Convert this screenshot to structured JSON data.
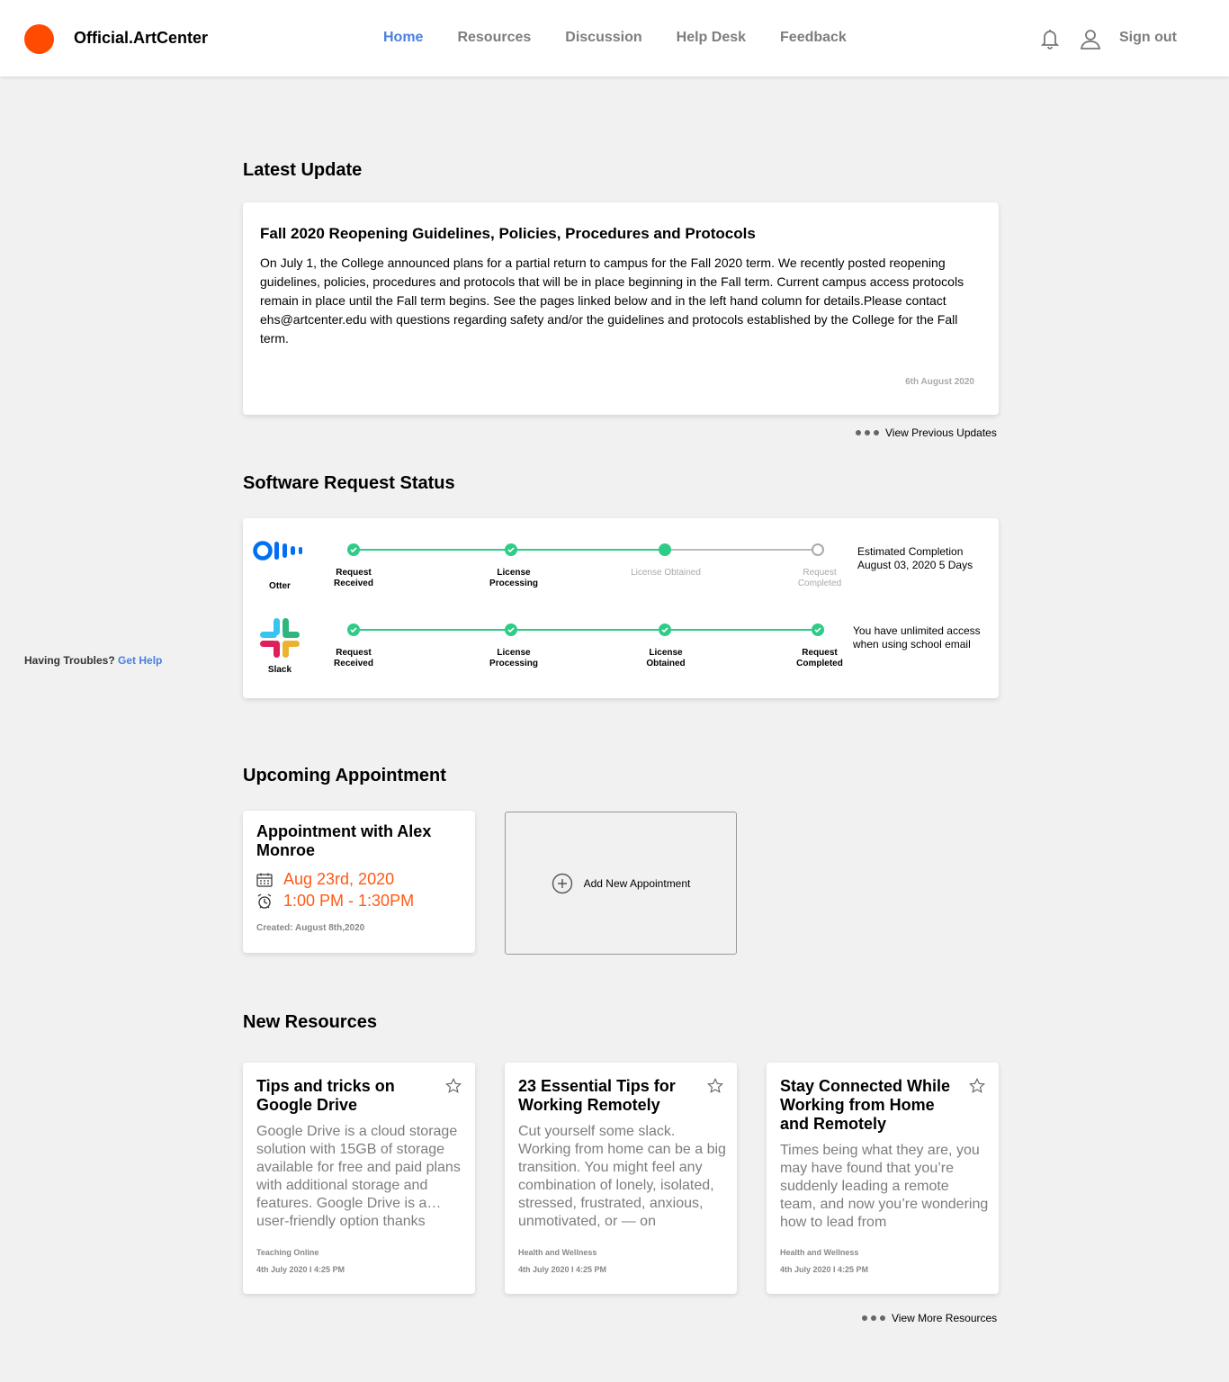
{
  "header": {
    "brand": "Official.ArtCenter",
    "nav": [
      "Home",
      "Resources",
      "Discussion",
      "Help Desk",
      "Feedback"
    ],
    "active_nav": "Home",
    "sign_out": "Sign out",
    "accent_color": "#4a7fe0",
    "logo_color": "#ff4b00"
  },
  "sidebar": {
    "help_text": "Having Troubles?",
    "help_link": "Get Help"
  },
  "latest": {
    "section_title": "Latest Update",
    "title": "Fall 2020 Reopening Guidelines, Policies, Procedures and Protocols",
    "body": "On July 1, the College announced plans for a partial return to campus for the Fall 2020 term. We recently posted reopening guidelines, policies, procedures and protocols that will be in place beginning in the Fall term. Current campus access protocols remain in place until the Fall term begins. See the pages linked below and in the left hand column for details.Please contact ehs@artcenter.edu with questions regarding safety and/or the guidelines and protocols established by the College for the Fall term.",
    "date": "6th August 2020",
    "view_previous": "View Previous Updates"
  },
  "software": {
    "section_title": "Software Request Status",
    "apps": [
      {
        "name": "Otter",
        "steps": [
          "Request Received",
          "License Processing",
          "License Obtained",
          "Request Completed"
        ],
        "note_line1": "Estimated Completion",
        "note_line2": "August 03, 2020 5 Days"
      },
      {
        "name": "Slack",
        "steps": [
          "Request Received",
          "License Processing",
          "License Obtained",
          "Request Completed"
        ],
        "note_line1": "You have unlimited access",
        "note_line2": "when using school email"
      }
    ],
    "status_color": "#2ecc87"
  },
  "appointment": {
    "section_title": "Upcoming Appointment",
    "title": "Appointment with Alex Monroe",
    "date": "Aug 23rd, 2020",
    "time": "1:00 PM - 1:30PM",
    "created": "Created: August 8th,2020",
    "add_label": "Add New Appointment",
    "highlight_color": "#ff5a14"
  },
  "resources": {
    "section_title": "New Resources",
    "items": [
      {
        "title": "Tips and tricks on Google Drive",
        "body": "Google Drive is a cloud storage solution with 15GB of storage available for free and paid plans with additional storage and features. Google Drive is a… user-friendly option thanks",
        "category": "Teaching Online",
        "date": "4th July 2020  I  4:25 PM"
      },
      {
        "title": "23 Essential Tips for Working Remotely",
        "body": "Cut yourself some slack. Working from home can be a big transition. You might feel any combination of lonely, isolated, stressed, frustrated, anxious, unmotivated, or — on",
        "category": "Health and Wellness",
        "date": "4th July 2020  I  4:25 PM"
      },
      {
        "title": "Stay Connected While Working from Home and Remotely",
        "body": "Times being what they are, you may have found that you’re suddenly leading a remote team, and now you’re wondering how to lead from",
        "category": "Health and Wellness",
        "date": "4th July 2020  I  4:25 PM"
      }
    ],
    "view_more": "View More Resources"
  }
}
